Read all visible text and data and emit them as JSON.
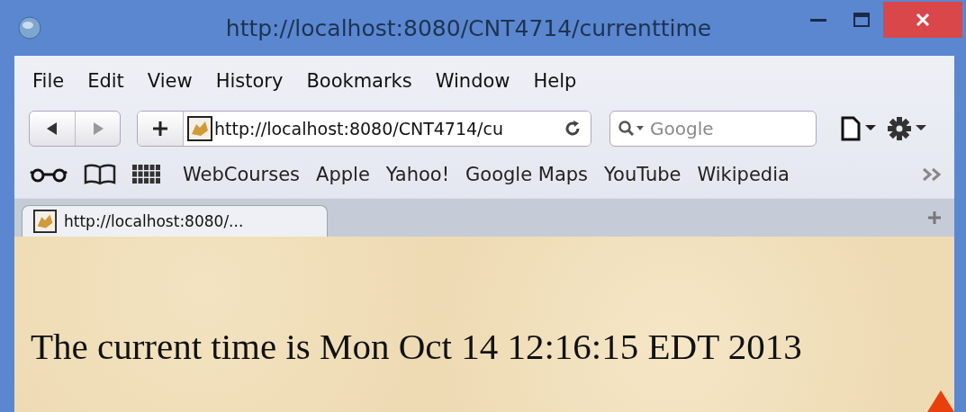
{
  "window": {
    "title": "http://localhost:8080/CNT4714/currenttime"
  },
  "menu": [
    "File",
    "Edit",
    "View",
    "History",
    "Bookmarks",
    "Window",
    "Help"
  ],
  "toolbar": {
    "url": "http://localhost:8080/CNT4714/cu",
    "search": {
      "placeholder": "Google"
    }
  },
  "bookmarks": [
    "WebCourses",
    "Apple",
    "Yahoo!",
    "Google Maps",
    "YouTube",
    "Wikipedia"
  ],
  "tabs": [
    {
      "label": "http://localhost:8080/...",
      "selected": true
    }
  ],
  "page": {
    "text": "The current time is Mon Oct 14 12:16:15 EDT 2013"
  }
}
